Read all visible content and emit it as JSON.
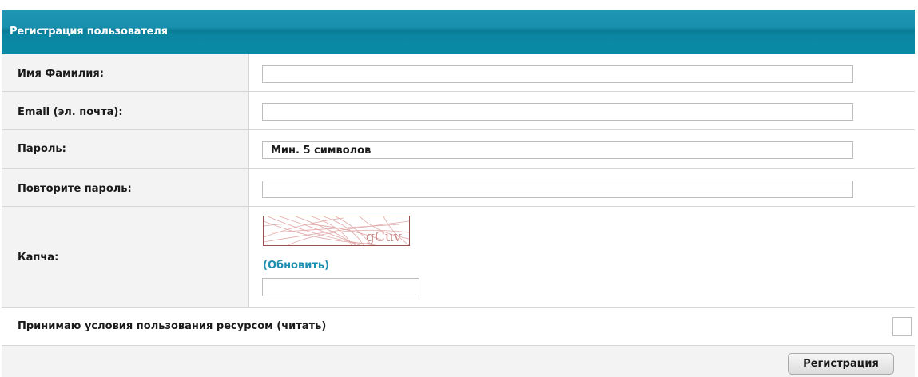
{
  "form": {
    "title": "Регистрация пользователя",
    "rows": {
      "name": {
        "label": "Имя Фамилия:",
        "value": ""
      },
      "email": {
        "label": "Email (эл. почта):",
        "value": ""
      },
      "password": {
        "label": "Пароль:",
        "placeholder": "Мин. 5 символов",
        "value": ""
      },
      "password_repeat": {
        "label": "Повторите пароль:",
        "value": ""
      },
      "captcha": {
        "label": "Капча:",
        "image_text": "gCuv",
        "refresh_link": "(Обновить)",
        "value": ""
      }
    },
    "terms": {
      "label": "Принимаю условия пользования ресурсом (читать)",
      "checked": false
    },
    "submit_label": "Регистрация"
  },
  "colors": {
    "header": "#0a8aa6",
    "link": "#1f8eb0",
    "captcha_border": "#9b5050"
  }
}
